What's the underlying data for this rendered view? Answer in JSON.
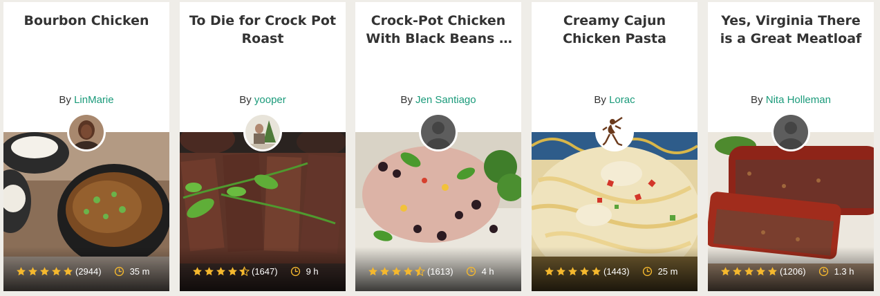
{
  "cards": [
    {
      "title": "Bourbon Chicken",
      "by": "By",
      "author": "LinMarie",
      "rating": 5,
      "reviews": "(2944)",
      "time": "35 m",
      "avatar_icon": "user-photo-icon"
    },
    {
      "title": "To Die for Crock Pot Roast",
      "by": "By",
      "author": "yooper",
      "rating": 4.5,
      "reviews": "(1647)",
      "time": "9 h",
      "avatar_icon": "user-photo-icon"
    },
    {
      "title": "Crock-Pot Chicken With Black Beans & Cream Cheese",
      "by": "By",
      "author": "Jen Santiago",
      "rating": 4.5,
      "reviews": "(1613)",
      "time": "4 h",
      "avatar_icon": "default-user-icon"
    },
    {
      "title": "Creamy Cajun Chicken Pasta",
      "by": "By",
      "author": "Lorac",
      "rating": 5,
      "reviews": "(1443)",
      "time": "25 m",
      "avatar_icon": "kokopelli-icon"
    },
    {
      "title": "Yes, Virginia There is a Great Meatloaf",
      "by": "By",
      "author": "Nita Holleman",
      "rating": 5,
      "reviews": "(1206)",
      "time": "1.3 h",
      "avatar_icon": "default-user-icon"
    }
  ],
  "colors": {
    "author_link": "#1a9a7a",
    "star": "#f5b82e",
    "background": "#efede8"
  }
}
